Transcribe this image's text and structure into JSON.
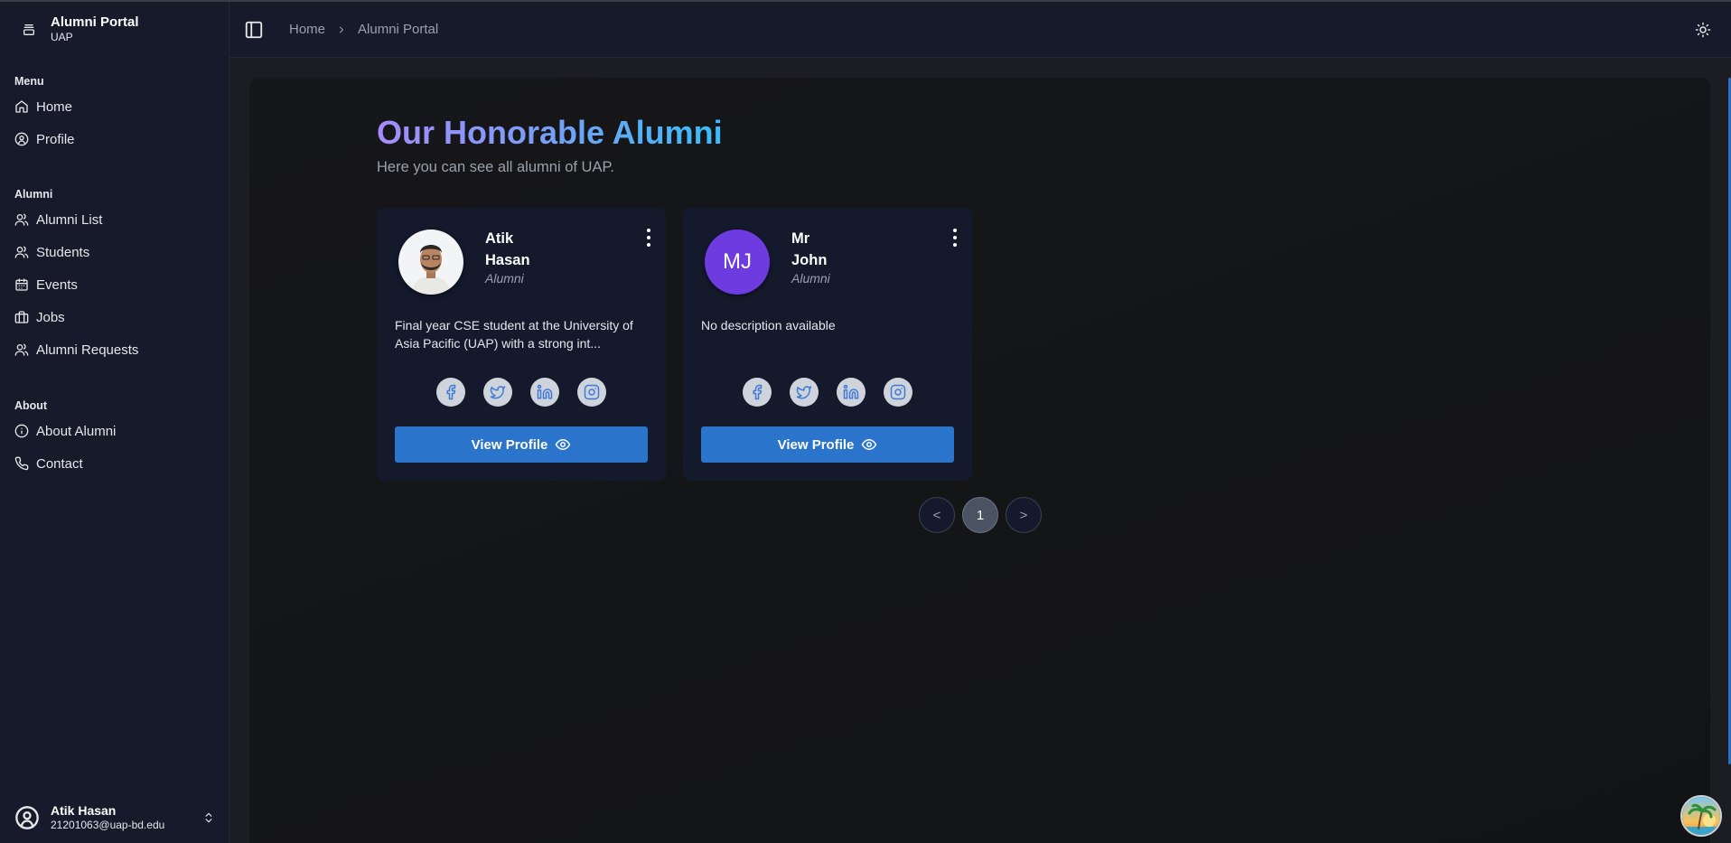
{
  "app": {
    "title": "Alumni Portal",
    "subtitle": "UAP"
  },
  "sidebar": {
    "groups": [
      {
        "label": "Menu",
        "items": [
          {
            "label": "Home",
            "icon": "home-icon"
          },
          {
            "label": "Profile",
            "icon": "user-circle-icon"
          }
        ]
      },
      {
        "label": "Alumni",
        "items": [
          {
            "label": "Alumni List",
            "icon": "users-icon"
          },
          {
            "label": "Students",
            "icon": "users-icon"
          },
          {
            "label": "Events",
            "icon": "calendar-icon"
          },
          {
            "label": "Jobs",
            "icon": "briefcase-icon"
          },
          {
            "label": "Alumni Requests",
            "icon": "users-icon"
          }
        ]
      },
      {
        "label": "About",
        "items": [
          {
            "label": "About Alumni",
            "icon": "info-icon"
          },
          {
            "label": "Contact",
            "icon": "phone-icon"
          }
        ]
      }
    ],
    "user": {
      "name": "Atik Hasan",
      "email": "21201063@uap-bd.edu"
    }
  },
  "breadcrumb": {
    "home": "Home",
    "current": "Alumni Portal"
  },
  "page": {
    "title": "Our Honorable Alumni",
    "subtitle": "Here you can see all alumni of UAP."
  },
  "cards": [
    {
      "first_name": "Atik",
      "last_name": "Hasan",
      "role": "Alumni",
      "initials": "",
      "description": "Final year CSE student at the University of Asia Pacific (UAP) with a strong int...",
      "view_label": "View Profile"
    },
    {
      "first_name": "Mr",
      "last_name": "John",
      "role": "Alumni",
      "initials": "MJ",
      "description": "No description available",
      "view_label": "View Profile"
    }
  ],
  "pagination": {
    "prev": "<",
    "current": "1",
    "next": ">"
  },
  "colors": {
    "accent": "#2b74cc",
    "sidebar_bg": "#171a2b",
    "card_bg": "#141a2c",
    "avatar_bg": "#6d3be0"
  }
}
